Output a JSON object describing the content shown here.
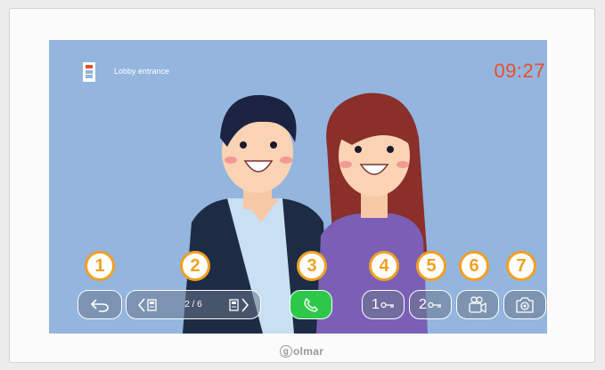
{
  "screen": {
    "entrance_label": "Lobby entrance",
    "time": "09:27",
    "camera_counter": "2 / 6"
  },
  "buttons": {
    "lock1_number": "1",
    "lock2_number": "2"
  },
  "callouts": [
    "1",
    "2",
    "3",
    "4",
    "5",
    "6",
    "7"
  ],
  "brand": {
    "initial": "g",
    "rest": "olmar"
  },
  "colors": {
    "screen_bg": "#93b5de",
    "clock": "#e8502a",
    "callout": "#f0a020",
    "call_button": "#2dc84a"
  }
}
